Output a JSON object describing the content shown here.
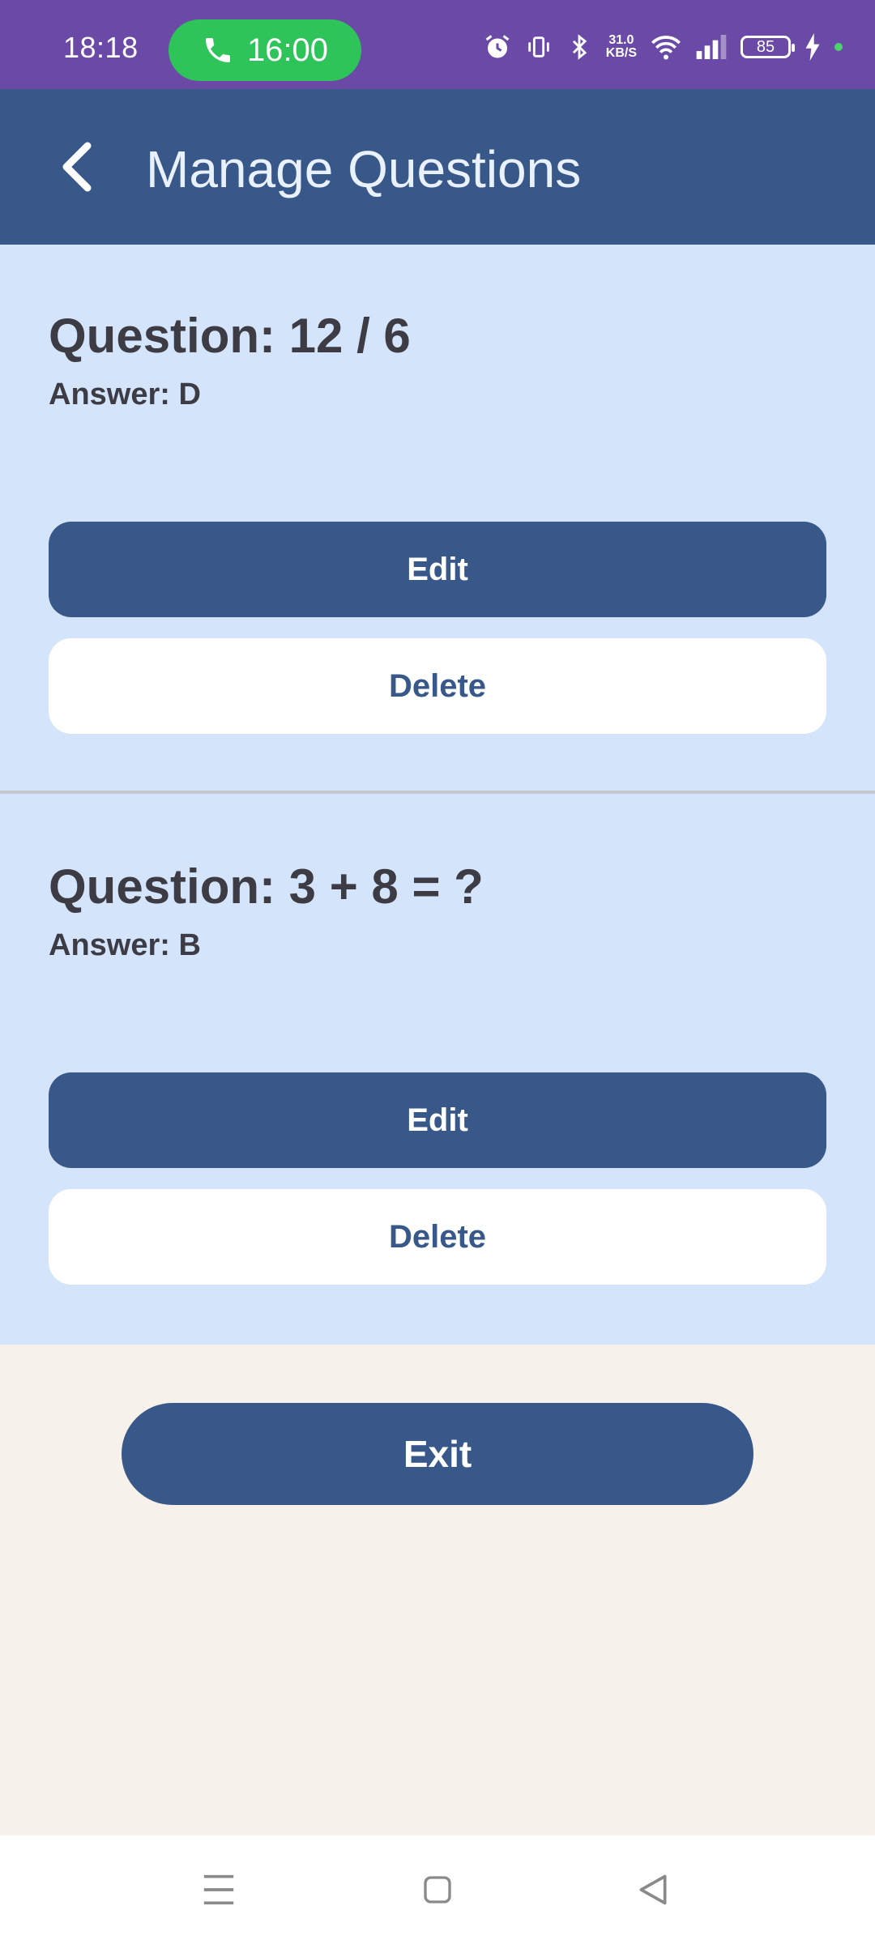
{
  "status_bar": {
    "time": "18:18",
    "call_timer": "16:00",
    "net_speed_value": "31.0",
    "net_speed_unit": "KB/S",
    "battery": "85",
    "accent_color": "#6a4aa6",
    "call_color": "#2ec45a"
  },
  "app_bar": {
    "title": "Manage Questions",
    "back_icon": "chevron-left-icon"
  },
  "questions": [
    {
      "question": "Question: 12 / 6",
      "answer": "Answer: D",
      "edit_label": "Edit",
      "delete_label": "Delete"
    },
    {
      "question": "Question: 3 + 8 = ?",
      "answer": "Answer: B",
      "edit_label": "Edit",
      "delete_label": "Delete"
    }
  ],
  "exit_label": "Exit",
  "colors": {
    "primary": "#385889",
    "list_background": "#d4e5fb",
    "page_background": "#f6f1ea"
  },
  "nav_icons": [
    "menu-icon",
    "home-square-icon",
    "back-triangle-icon"
  ]
}
